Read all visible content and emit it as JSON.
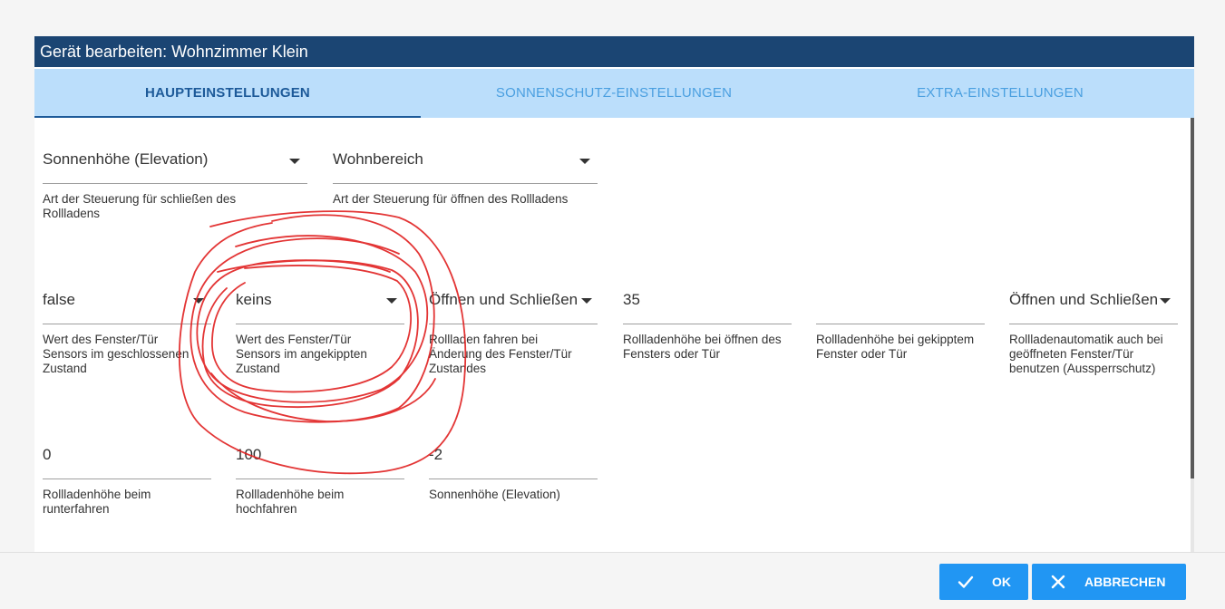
{
  "dialog": {
    "title": "Gerät bearbeiten: Wohnzimmer Klein",
    "tabs": [
      "HAUPTEINSTELLUNGEN",
      "SONNENSCHUTZ-EINSTELLUNGEN",
      "EXTRA-EINSTELLUNGEN"
    ],
    "active_tab": "HAUPTEINSTELLUNGEN"
  },
  "row1": {
    "close_control": {
      "value": "Sonnenhöhe (Elevation)",
      "helper": "Art der Steuerung für schließen des Rollladens"
    },
    "open_control": {
      "value": "Wohnbereich",
      "helper": "Art der Steuerung für öffnen des Rollladens"
    }
  },
  "row2": {
    "sensor_closed": {
      "value": "false",
      "helper": "Wert des Fenster/Tür Sensors im geschlossenen Zustand"
    },
    "sensor_tilted": {
      "value": "keins",
      "helper": "Wert des Fenster/Tür Sensors im angekippten Zustand"
    },
    "drive_on_change": {
      "value": "Öffnen und Schließen",
      "helper": "Rollladen fahren bei Änderung des Fenster/Tür Zustandes"
    },
    "height_open": {
      "value": "35",
      "helper": "Rollladenhöhe bei öffnen des Fensters oder Tür"
    },
    "height_tilted": {
      "value": "",
      "helper": "Rollladenhöhe bei gekipptem Fenster oder Tür"
    },
    "lockout": {
      "value": "Öffnen und Schließen",
      "helper": "Rollladenautomatik auch bei geöffneten Fenster/Tür benutzen (Aussperrschutz)"
    }
  },
  "row3": {
    "height_down": {
      "value": "0",
      "helper": "Rollladenhöhe beim runterfahren"
    },
    "height_up": {
      "value": "100",
      "helper": "Rollladenhöhe beim hochfahren"
    },
    "elevation": {
      "value": "-2",
      "helper": "Sonnenhöhe (Elevation)"
    }
  },
  "footer": {
    "ok_label": "OK",
    "cancel_label": "ABBRECHEN"
  },
  "colors": {
    "titlebar": "#1b4573",
    "tabs_bg": "#bbdefb",
    "active_tab": "#1d5a99",
    "inactive_tab": "#4a9fe0",
    "button": "#2196f3",
    "annotation": "#e02020"
  },
  "icons": {
    "ok": "check-icon",
    "cancel": "close-icon",
    "dropdown": "caret-down-icon"
  }
}
